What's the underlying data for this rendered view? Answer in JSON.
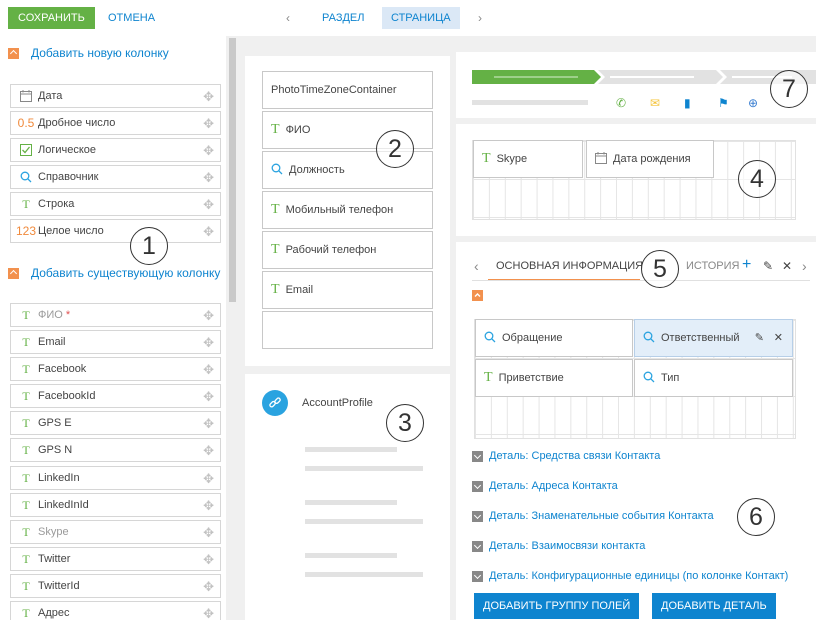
{
  "toolbar": {
    "save": "СОХРАНИТЬ",
    "cancel": "ОТМЕНА",
    "prev": "‹",
    "next": "›",
    "section": "РАЗДЕЛ",
    "page": "СТРАНИЦА"
  },
  "left": {
    "add_new": "Добавить новую колонку",
    "new_types": [
      {
        "icon": "calendar-icon",
        "glyph": "📅",
        "label": "Дата"
      },
      {
        "icon": "decimal-icon",
        "glyph": "0.5",
        "label": "Дробное число"
      },
      {
        "icon": "checkbox-icon",
        "glyph": "☑",
        "label": "Логическое"
      },
      {
        "icon": "search-icon",
        "glyph": "⚲",
        "label": "Справочник"
      },
      {
        "icon": "text-icon",
        "glyph": "T",
        "label": "Строка"
      },
      {
        "icon": "integer-icon",
        "glyph": "123",
        "label": "Целое число"
      }
    ],
    "add_existing": "Добавить существующую колонку",
    "existing": [
      {
        "label": "ФИО",
        "required": "*",
        "muted": true
      },
      {
        "label": "Email"
      },
      {
        "label": "Facebook"
      },
      {
        "label": "FacebookId"
      },
      {
        "label": "GPS E"
      },
      {
        "label": "GPS N"
      },
      {
        "label": "LinkedIn"
      },
      {
        "label": "LinkedInId"
      },
      {
        "label": "Skype",
        "muted": true
      },
      {
        "label": "Twitter"
      },
      {
        "label": "TwitterId"
      },
      {
        "label": "Адрес"
      }
    ]
  },
  "profile_fields": {
    "container": "PhotoTimeZoneContainer",
    "items": [
      {
        "icon": "text-icon",
        "label": "ФИО"
      },
      {
        "icon": "search-icon",
        "label": "Должность"
      },
      {
        "icon": "text-icon",
        "label": "Мобильный телефон"
      },
      {
        "icon": "text-icon",
        "label": "Рабочий телефон"
      },
      {
        "icon": "text-icon",
        "label": "Email"
      }
    ]
  },
  "account_profile": "AccountProfile",
  "header_grid": [
    {
      "icon": "text-icon",
      "label": "Skype"
    },
    {
      "icon": "calendar-icon",
      "label": "Дата рождения"
    }
  ],
  "tabs": {
    "main": "ОСНОВНАЯ ИНФОРМАЦИЯ",
    "history": "ИСТОРИЯ",
    "add": "+",
    "edit": "✎",
    "close": "✕",
    "prev": "‹",
    "next": "›"
  },
  "tab_grid": [
    {
      "icon": "search-icon",
      "label": "Обращение"
    },
    {
      "icon": "search-icon",
      "label": "Ответственный",
      "selected": true
    },
    {
      "icon": "text-icon",
      "label": "Приветствие"
    },
    {
      "icon": "search-icon",
      "label": "Тип"
    }
  ],
  "details": [
    "Деталь: Средства связи Контакта",
    "Деталь: Адреса Контакта",
    "Деталь: Знаменательные события Контакта",
    "Деталь: Взаимосвязи контакта",
    "Деталь: Конфигурационные единицы (по колонке Контакт)"
  ],
  "buttons": {
    "add_group": "ДОБАВИТЬ ГРУППУ ПОЛЕЙ",
    "add_detail": "ДОБАВИТЬ ДЕТАЛЬ"
  },
  "callouts": [
    "1",
    "2",
    "3",
    "4",
    "5",
    "6",
    "7"
  ],
  "colors": {
    "accent": "#0e84cf",
    "save": "#64b145",
    "orange": "#f2914e"
  }
}
